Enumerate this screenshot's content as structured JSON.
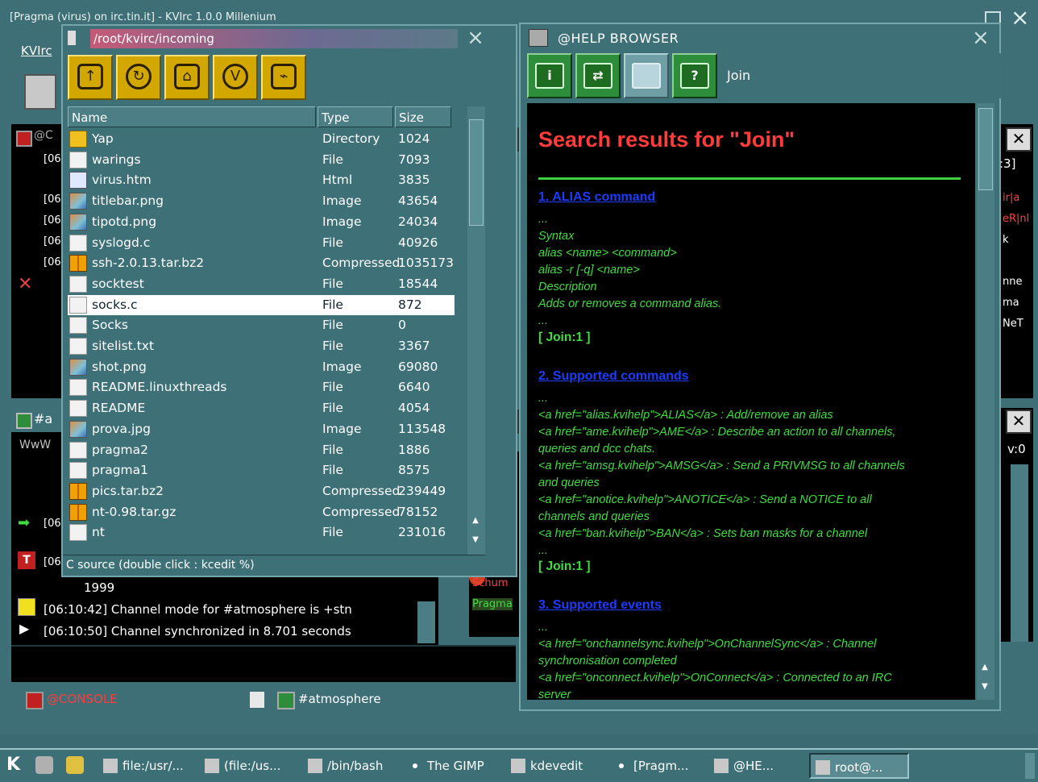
{
  "main_window": {
    "title": "[Pragma (virus) on irc.tin.it] - KVIrc 1.0.0 Millenium",
    "menu_first": "KVIrc",
    "channel_lines": [
      {
        "time": "1999",
        "text": ""
      },
      {
        "time": "[06:10:42]",
        "text": "Channel mode for #atmosphere is +stn"
      },
      {
        "time": "[06:10:50]",
        "text": "Channel synchronized in 8.701 seconds"
      }
    ],
    "status_console": "@CONSOLE",
    "status_channel": "#atmosphere",
    "left_fragments": [
      "@C",
      "[06",
      "[06",
      "[06",
      "[06",
      "[06",
      "#a",
      "WwW",
      "[06",
      "[06"
    ],
    "right_fragments": [
      "ir|a",
      "eR|nl",
      "k",
      "nne",
      "ma",
      "NeT",
      ":3]",
      "b:",
      "v:0"
    ]
  },
  "file_manager": {
    "path": "/root/kvirc/incoming",
    "columns": {
      "name": "Name",
      "type": "Type",
      "size": "Size"
    },
    "files": [
      {
        "name": "Yap",
        "type": "Directory",
        "size": "1024",
        "icon": "folder-icon"
      },
      {
        "name": "warings",
        "type": "File",
        "size": "7093",
        "icon": "file-icon"
      },
      {
        "name": "virus.htm",
        "type": "Html",
        "size": "3835",
        "icon": "html-file-icon"
      },
      {
        "name": "titlebar.png",
        "type": "Image",
        "size": "43654",
        "icon": "image-file-icon"
      },
      {
        "name": "tipotd.png",
        "type": "Image",
        "size": "24034",
        "icon": "image-file-icon"
      },
      {
        "name": "syslogd.c",
        "type": "File",
        "size": "40926",
        "icon": "file-icon"
      },
      {
        "name": "ssh-2.0.13.tar.bz2",
        "type": "Compressed",
        "size": "1035173",
        "icon": "archive-icon"
      },
      {
        "name": "socktest",
        "type": "File",
        "size": "18544",
        "icon": "file-icon"
      },
      {
        "name": "socks.c",
        "type": "File",
        "size": "872",
        "icon": "file-icon"
      },
      {
        "name": "Socks",
        "type": "File",
        "size": "0",
        "icon": "file-icon"
      },
      {
        "name": "sitelist.txt",
        "type": "File",
        "size": "3367",
        "icon": "file-icon"
      },
      {
        "name": "shot.png",
        "type": "Image",
        "size": "69080",
        "icon": "image-file-icon"
      },
      {
        "name": "README.linuxthreads",
        "type": "File",
        "size": "6640",
        "icon": "file-icon"
      },
      {
        "name": "README",
        "type": "File",
        "size": "4054",
        "icon": "file-icon"
      },
      {
        "name": "prova.jpg",
        "type": "Image",
        "size": "113548",
        "icon": "image-file-icon"
      },
      {
        "name": "pragma2",
        "type": "File",
        "size": "1886",
        "icon": "file-icon"
      },
      {
        "name": "pragma1",
        "type": "File",
        "size": "8575",
        "icon": "file-icon"
      },
      {
        "name": "pics.tar.bz2",
        "type": "Compressed",
        "size": "239449",
        "icon": "archive-icon"
      },
      {
        "name": "nt-0.98.tar.gz",
        "type": "Compressed",
        "size": "78152",
        "icon": "archive-icon"
      },
      {
        "name": "nt",
        "type": "File",
        "size": "231016",
        "icon": "file-icon"
      }
    ],
    "selected_index": 8,
    "status": "C source (double click : kcedit %)"
  },
  "help_browser": {
    "title": "@HELP BROWSER",
    "topic": "Join",
    "heading": "Search results for \"Join\"",
    "result1_link": "1. ALIAS command",
    "result1_lines": [
      "...",
      "Syntax",
      "alias <name> <command>",
      "alias -r [-q] <name>",
      "Description",
      "Adds or removes a command alias.",
      "..."
    ],
    "result1_tag": "[ Join:1 ]",
    "result2_link": "2. Supported commands",
    "result2_lines": [
      "...",
      "<a href=\"alias.kvihelp\">ALIAS</a> : Add/remove an alias",
      "<a href=\"ame.kvihelp\">AME</a> : Describe an action to all channels,",
      "queries and dcc chats.",
      "<a href=\"amsg.kvihelp\">AMSG</a> : Send a PRIVMSG to all channels",
      "and queries",
      "<a href=\"anotice.kvihelp\">ANOTICE</a> : Send a NOTICE to all",
      "channels and queries",
      "<a href=\"ban.kvihelp\">BAN</a> : Sets ban masks for a channel",
      "..."
    ],
    "result2_tag": "[ Join:1 ]",
    "result3_link": "3. Supported events",
    "result3_lines": [
      "...",
      "<a href=\"onchannelsync.kvihelp\">OnChannelSync</a> : Channel",
      "synchronisation completed",
      "<a href=\"onconnect.kvihelp\">OnConnect</a> : Connected to an IRC",
      "server"
    ]
  },
  "taskbar": {
    "start": "K",
    "items": [
      {
        "label": "file:/usr/...",
        "icon": "file-manager-icon"
      },
      {
        "label": "(file:/us...",
        "icon": "pen-icon"
      },
      {
        "label": "/bin/bash",
        "icon": "terminal-icon"
      },
      {
        "label": "The GIMP",
        "icon": "dot-icon"
      },
      {
        "label": "kdevedit",
        "icon": "editor-icon"
      },
      {
        "label": "[Pragm...",
        "icon": "dot-icon"
      },
      {
        "label": "@HE...",
        "icon": "help-icon"
      },
      {
        "label": "root@...",
        "icon": "shell-icon"
      }
    ]
  }
}
